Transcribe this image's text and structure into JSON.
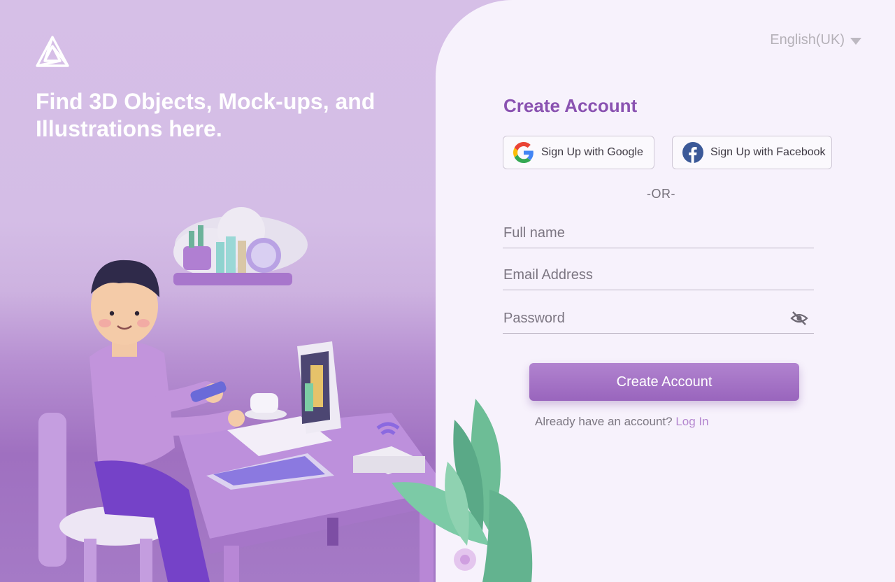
{
  "hero": {
    "tagline": "Find 3D Objects, Mock-ups, and Illustrations here.",
    "logo_icon": "triangle-logo-icon",
    "illustration": "person-at-desk-illustration"
  },
  "language": {
    "selected": "English(UK)"
  },
  "form": {
    "title": "Create Account",
    "google_label": "Sign Up with Google",
    "facebook_label": "Sign Up with Facebook",
    "divider": "-OR-",
    "fullname_placeholder": "Full name",
    "email_placeholder": "Email Address",
    "password_placeholder": "Password",
    "submit_label": "Create Account",
    "login_prompt": "Already have an account?",
    "login_link": "Log In"
  },
  "colors": {
    "accent": "#8a52b1",
    "button": "#a472c6",
    "link": "#b486cf",
    "panel_bg": "#f7f2fc"
  }
}
